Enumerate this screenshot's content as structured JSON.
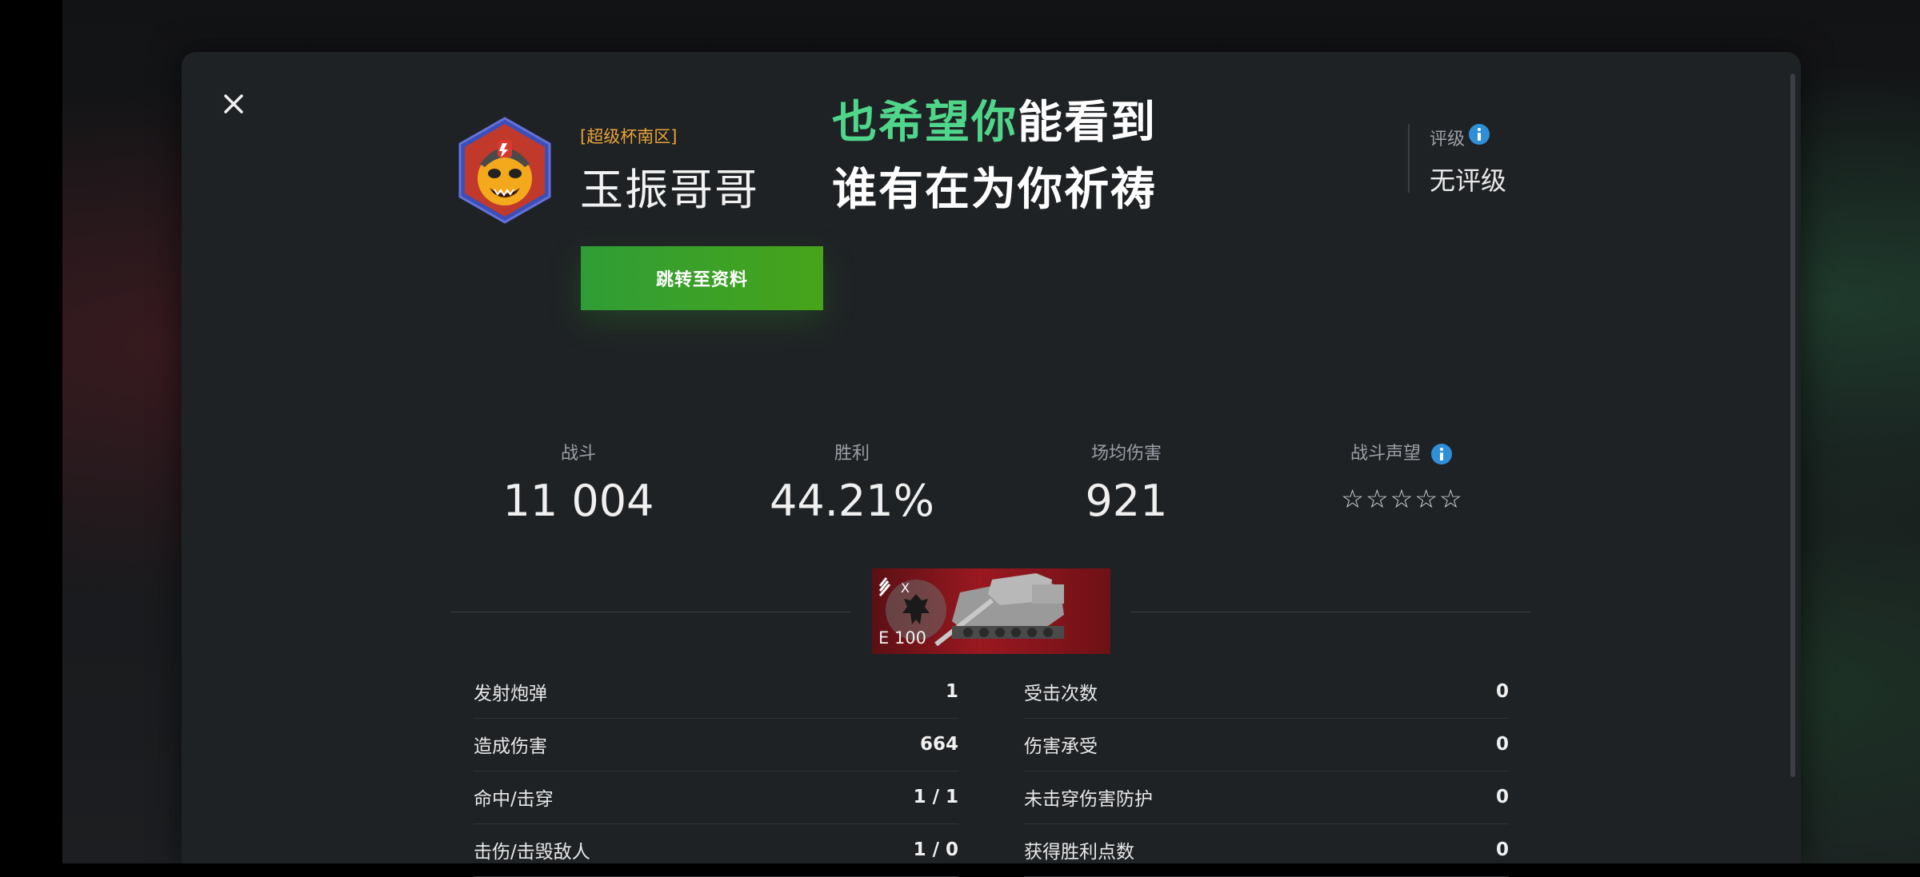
{
  "header": {
    "clan_tag": "[超级杯南区]",
    "player_name": "玉振哥哥",
    "goto_profile_label": "跳转至资料",
    "rating_label": "评级",
    "rating_value": "无评级"
  },
  "lyrics": {
    "line1_highlight": "也希望你",
    "line1_rest": "能看到",
    "line2": "谁有在为你祈祷"
  },
  "stats": {
    "battles_label": "战斗",
    "battles_value": "11 004",
    "wins_label": "胜利",
    "wins_value": "44.21%",
    "avg_damage_label": "场均伤害",
    "avg_damage_value": "921",
    "reputation_label": "战斗声望",
    "reputation_stars_filled": 0,
    "reputation_stars_total": 5
  },
  "tank": {
    "name": "E 100",
    "tier": "X",
    "nation_icon": "german-eagle-icon"
  },
  "details_left": [
    {
      "label": "发射炮弹",
      "value": "1"
    },
    {
      "label": "造成伤害",
      "value": "664"
    },
    {
      "label": "命中/击穿",
      "value": "1 / 1"
    },
    {
      "label": "击伤/击毁敌人",
      "value": "1 / 0"
    }
  ],
  "details_right": [
    {
      "label": "受击次数",
      "value": "0"
    },
    {
      "label": "伤害承受",
      "value": "0"
    },
    {
      "label": "未击穿伤害防护",
      "value": "0"
    },
    {
      "label": "获得胜利点数",
      "value": "0"
    }
  ],
  "icons": {
    "close": "close-icon",
    "info": "info-icon",
    "star": "star-outline-icon"
  },
  "colors": {
    "accent_green": "#3aa52b",
    "highlight_lyric": "#4fd68a",
    "clan_tag": "#e8a23a",
    "tank_card_red": "#9a1820",
    "info_blue": "#2f8fd8"
  }
}
